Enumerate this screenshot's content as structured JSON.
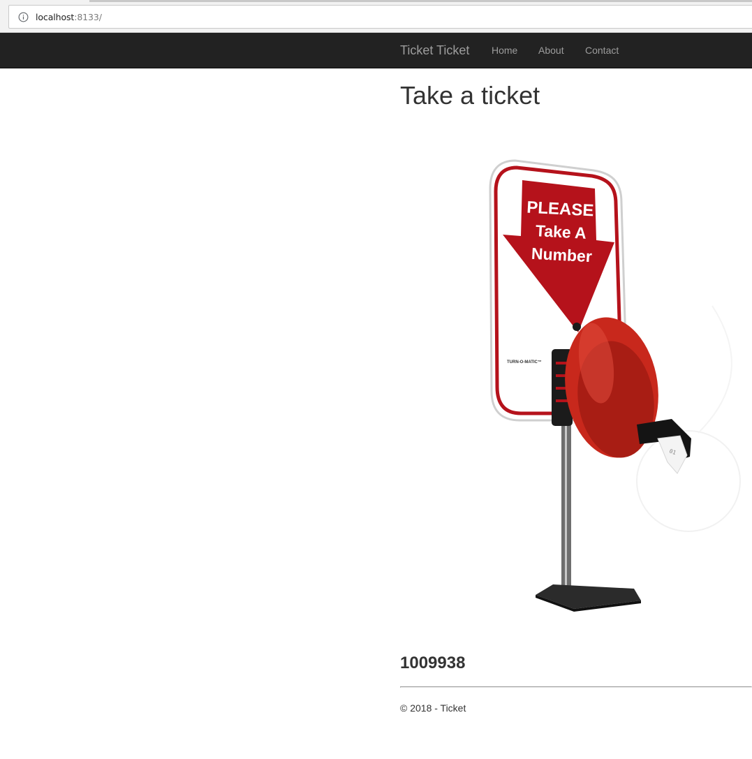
{
  "browser": {
    "url_host": "localhost",
    "url_rest": ":8133/"
  },
  "navbar": {
    "brand": "Ticket Ticket",
    "links": [
      {
        "label": "Home"
      },
      {
        "label": "About"
      },
      {
        "label": "Contact"
      }
    ]
  },
  "main": {
    "title": "Take a ticket",
    "image": {
      "sign_line1": "PLEASE",
      "sign_line2": "Take A",
      "sign_line3": "Number",
      "brand_mark": "TURN-O-MATIC™",
      "ticket_stub": "01"
    },
    "ticket_number": "1009938"
  },
  "footer": {
    "text": "© 2018 - Ticket"
  },
  "colors": {
    "navbar_bg": "#222222",
    "nav_text": "#9d9d9d",
    "sign_red": "#b5121b",
    "dispenser_red": "#c8281c"
  }
}
